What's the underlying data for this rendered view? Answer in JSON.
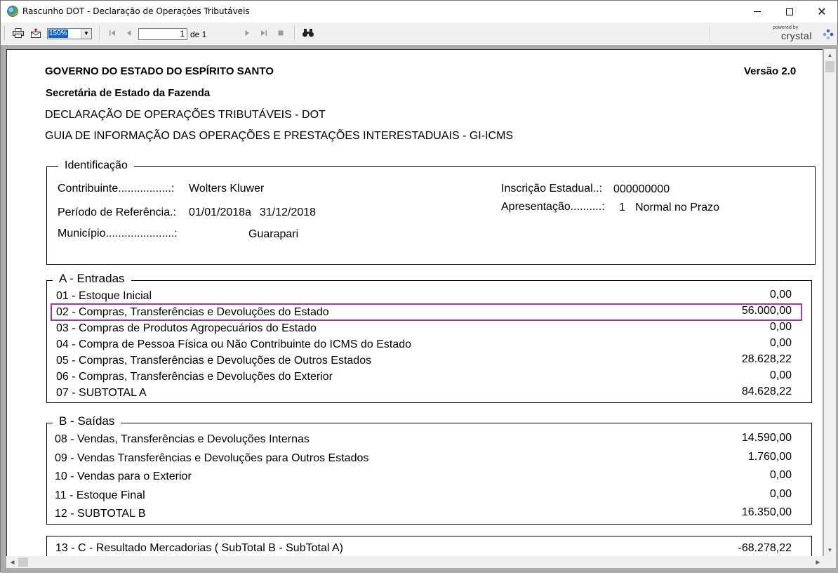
{
  "window": {
    "title": "Rascunho DOT - Declaração de Operações Tributáveis",
    "minimize": "–",
    "maximize": "☐",
    "close": "✕"
  },
  "toolbar": {
    "zoom": "150%",
    "page_input": "1",
    "page_of": "de 1",
    "icons": [
      "print-icon",
      "export-icon",
      "first-page-icon",
      "prev-page-icon",
      "next-page-icon",
      "last-page-icon",
      "stop-icon",
      "search-icon"
    ],
    "brand_powered": "powered by",
    "brand_name": "crystal"
  },
  "report": {
    "header": {
      "government": "GOVERNO DO ESTADO DO ESPÍRITO SANTO",
      "version": "Versão 2.0",
      "secretariat": "Secretária de Estado da Fazenda",
      "declaration": "DECLARAÇÃO DE OPERAÇÕES TRIBUTÁVEIS - DOT",
      "guide": "GUIA DE INFORMAÇÃO DAS OPERAÇÕES E PRESTAÇÕES INTERESTADUAIS  - GI-ICMS"
    },
    "identificacao": {
      "legend": "Identificação",
      "contribuinte_label": "Contribuinte.................:",
      "contribuinte_value": "Wolters Kluwer",
      "periodo_label": "Período de Referência.:",
      "periodo_inicio": "01/01/2018a",
      "periodo_fim": "31/12/2018",
      "municipio_label": "Município......................:",
      "municipio_value": "Guarapari",
      "inscricao_label": "Inscrição Estadual..:",
      "inscricao_value": "000000000",
      "apresentacao_label": "Apresentação..........:",
      "apresentacao_code": "1",
      "apresentacao_value": "Normal no Prazo"
    },
    "entradas": {
      "legend": "A - Entradas",
      "rows": [
        {
          "label": "01 - Estoque Inicial",
          "value": "0,00"
        },
        {
          "label": "02 - Compras, Transferências e Devoluções do Estado",
          "value": "56.000,00"
        },
        {
          "label": "03 - Compras de Produtos Agropecuários do Estado",
          "value": "0,00"
        },
        {
          "label": "04 - Compra de Pessoa Física ou Não Contribuinte do ICMS do Estado",
          "value": "0,00"
        },
        {
          "label": "05 - Compras, Transferências e Devoluções de Outros Estados",
          "value": "28.628,22"
        },
        {
          "label": "06 - Compras, Transferências e Devoluções do Exterior",
          "value": "0,00"
        },
        {
          "label": "07 - SUBTOTAL A",
          "value": "84.628,22"
        }
      ]
    },
    "saidas": {
      "legend": "B - Saídas",
      "rows": [
        {
          "label": "08 - Vendas, Transferências e Devoluções Internas",
          "value": "14.590,00"
        },
        {
          "label": "09 - Vendas Transferências e Devoluções para Outros Estados",
          "value": "1.760,00"
        },
        {
          "label": "10 - Vendas para o Exterior",
          "value": "0,00"
        },
        {
          "label": "11 - Estoque Final",
          "value": "0,00"
        },
        {
          "label": "12 - SUBTOTAL B",
          "value": "16.350,00"
        }
      ]
    },
    "resultado": {
      "label": "13 - C - Resultado Mercadorias ( SubTotal B - SubTotal A)",
      "value": "-68.278,22"
    }
  },
  "colors": {
    "highlight": "#9a3c9a",
    "viewport_bg": "#ababab",
    "toolbar_bg": "#f0f0f0"
  }
}
